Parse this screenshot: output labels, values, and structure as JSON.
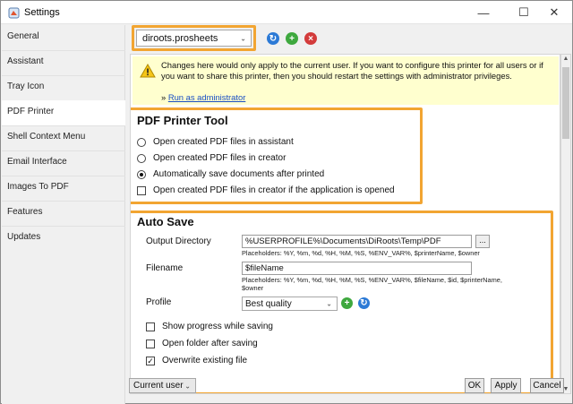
{
  "window": {
    "title": "Settings"
  },
  "sidebar": {
    "items": [
      {
        "label": "General"
      },
      {
        "label": "Assistant"
      },
      {
        "label": "Tray Icon"
      },
      {
        "label": "PDF Printer"
      },
      {
        "label": "Shell Context Menu"
      },
      {
        "label": "Email Interface"
      },
      {
        "label": "Images To PDF"
      },
      {
        "label": "Features"
      },
      {
        "label": "Updates"
      }
    ],
    "selected": "PDF Printer"
  },
  "printer_bar": {
    "selected_printer": "diroots.prosheets"
  },
  "warning": {
    "text": "Changes here would only apply to the current user. If you want to configure this printer for all users or if you want to share this printer, then you should restart the settings with administrator privileges.",
    "prefix": "» ",
    "link": "Run as administrator"
  },
  "pdf_printer_tool": {
    "title": "PDF Printer Tool",
    "options": [
      {
        "label": "Open created PDF files in assistant",
        "checked": false
      },
      {
        "label": "Open created PDF files in creator",
        "checked": false
      },
      {
        "label": "Automatically save documents after printed",
        "checked": true
      }
    ],
    "checkbox": {
      "label": "Open created PDF files in creator if the application is opened",
      "checked": false
    }
  },
  "auto_save": {
    "title": "Auto Save",
    "output_directory": {
      "label": "Output Directory",
      "value": "%USERPROFILE%\\Documents\\DiRoots\\Temp\\PDF",
      "browse": "...",
      "hint": "Placeholders: %Y, %m, %d, %H, %M, %S, %ENV_VAR%, $printerName, $owner"
    },
    "filename": {
      "label": "Filename",
      "value": "$fileName",
      "hint_line1": "Placeholders: %Y, %m, %d, %H, %M, %S, %ENV_VAR%, $fileName, $id, $printerName,",
      "hint_line2": "$owner"
    },
    "profile": {
      "label": "Profile",
      "value": "Best quality"
    },
    "checks": [
      {
        "label": "Show progress while saving",
        "checked": false
      },
      {
        "label": "Open folder after saving",
        "checked": false
      },
      {
        "label": "Overwrite existing file",
        "checked": true
      }
    ]
  },
  "footer": {
    "scope": "Current user",
    "ok": "OK",
    "apply": "Apply",
    "cancel": "Cancel"
  },
  "colors": {
    "highlight": "#f2a532",
    "warning_bg": "#ffffcf",
    "link": "#1a4fc4",
    "add_icon": "#3ea83e",
    "delete_icon": "#d33b3b",
    "refresh_icon": "#2c7ad6"
  }
}
